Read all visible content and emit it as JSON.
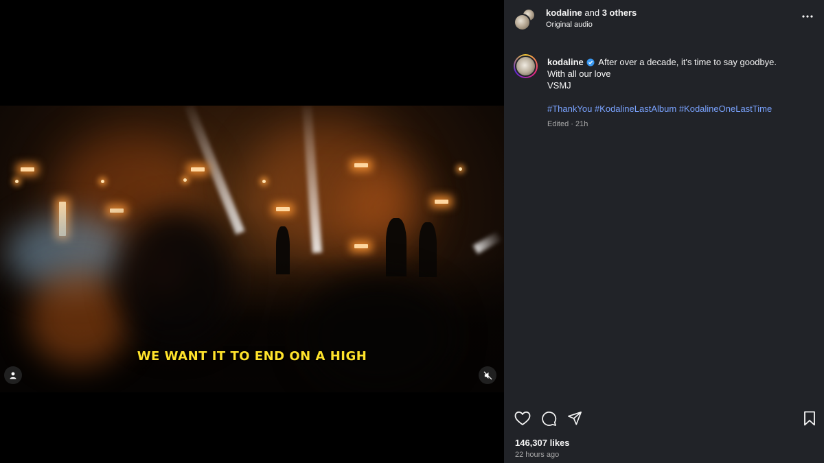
{
  "header": {
    "owner": "kodaline",
    "conjunction": "and",
    "collaborators": "3 others",
    "audio": "Original audio"
  },
  "caption": {
    "username": "kodaline",
    "lines": [
      "After over a decade, it's time to say goodbye.",
      "With all our love",
      "VSMJ"
    ],
    "hashtags": [
      "#ThankYou",
      "#KodalineLastAlbum",
      "#KodalineOneLastTime"
    ],
    "meta": "Edited · 21h"
  },
  "video": {
    "subtitle": "WE WANT IT TO END ON A HIGH",
    "muted": true
  },
  "engagement": {
    "likes": "146,307 likes",
    "posted": "22 hours ago"
  },
  "icons": {
    "more": "more-options-icon",
    "verified": "verified-badge-icon",
    "like": "heart-icon",
    "comment": "comment-icon",
    "share": "share-icon",
    "save": "bookmark-icon",
    "tags": "user-tag-icon",
    "mute": "muted-speaker-icon"
  },
  "colors": {
    "panel_bg": "#212328",
    "hashtag": "#7aa3ff",
    "subtitle": "#ffe32b",
    "verified": "#3897f0"
  }
}
